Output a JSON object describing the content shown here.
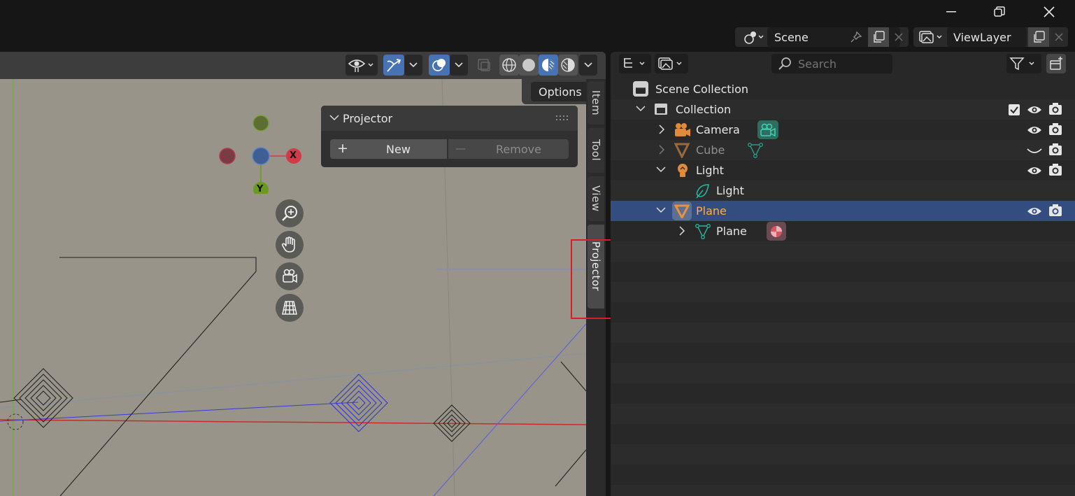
{
  "window": {
    "minimize": "—",
    "maximize": "❐",
    "close": "✕"
  },
  "top_header": {
    "scene_label": "Scene",
    "view_layer_label": "ViewLayer"
  },
  "viewport": {
    "options_label": "Options",
    "gizmo": {
      "x_label": "X",
      "y_label": "Y"
    },
    "projector_panel": {
      "title": "Projector",
      "new_label": "New",
      "remove_label": "Remove",
      "new_icon": "+",
      "remove_icon": "—"
    },
    "side_tabs": [
      "Item",
      "Tool",
      "View",
      "Projector"
    ],
    "highlighted_tab": "Projector"
  },
  "outliner": {
    "search_placeholder": "Search",
    "scene_collection": "Scene Collection",
    "rows": [
      {
        "label": "Collection",
        "icon": "collection-icon"
      },
      {
        "label": "Camera",
        "icon": "camera-icon"
      },
      {
        "label": "Cube",
        "icon": "mesh-icon"
      },
      {
        "label": "Light",
        "icon": "light-icon"
      },
      {
        "label": "Light",
        "icon": "light-data-icon"
      },
      {
        "label": "Plane",
        "icon": "mesh-icon",
        "selected": true
      },
      {
        "label": "Plane",
        "icon": "mesh-data-icon"
      }
    ]
  },
  "colors": {
    "accent_selected_row": "#334d80",
    "viewport_bg": "#989489",
    "highlight_box": "#e01b24",
    "x_axis": "#d23a47",
    "y_axis": "#6a9a1f",
    "z_axis": "#3f5f93",
    "object_orange": "#e08a3c",
    "data_teal": "#2db49a"
  }
}
